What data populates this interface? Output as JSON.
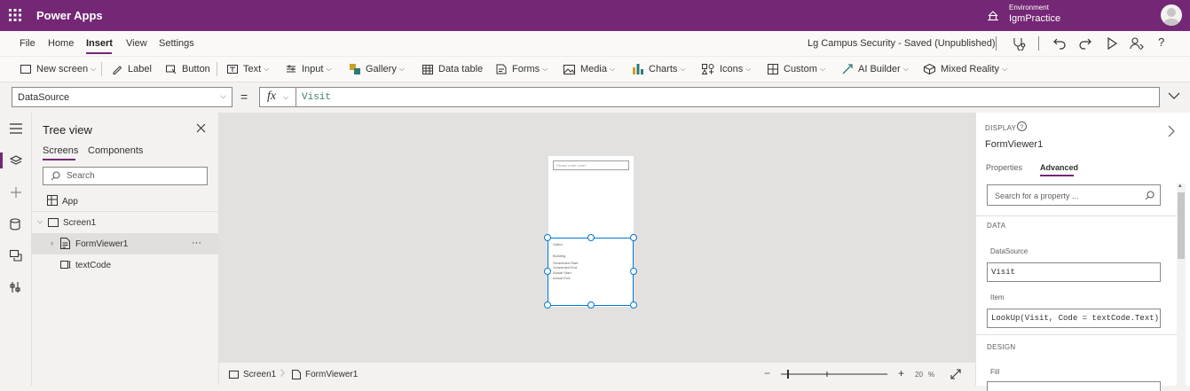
{
  "app": {
    "title": "Power Apps",
    "env_label": "Environment",
    "env_name": "IgmPractice"
  },
  "menu": {
    "items": [
      "File",
      "Home",
      "Insert",
      "View",
      "Settings"
    ],
    "active": "Insert",
    "status": "Lg Campus Security - Saved (Unpublished)"
  },
  "ribbon": {
    "new_screen": "New screen",
    "label": "Label",
    "button": "Button",
    "text": "Text",
    "input": "Input",
    "gallery": "Gallery",
    "data_table": "Data table",
    "forms": "Forms",
    "media": "Media",
    "charts": "Charts",
    "icons": "Icons",
    "custom": "Custom",
    "ai_builder": "AI Builder",
    "mixed_reality": "Mixed Reality"
  },
  "formula": {
    "property": "DataSource",
    "equals": "=",
    "fx": "fx",
    "value": "Visit"
  },
  "tree": {
    "title": "Tree view",
    "tabs": [
      "Screens",
      "Components"
    ],
    "search_placeholder": "Search",
    "app": "App",
    "screen": "Screen1",
    "form": "FormViewer1",
    "text_control": "textCode",
    "more": "···"
  },
  "canvas": {
    "input_placeholder": "Please enter code*",
    "form_fields": [
      "Visitor",
      "Building",
      "Scheduled Start",
      "Scheduled End",
      "Actual Start",
      "Actual End"
    ]
  },
  "statusbar": {
    "screen": "Screen1",
    "form": "FormViewer1",
    "zoom": "20",
    "zoom_unit": "%"
  },
  "props": {
    "display": "DISPLAY",
    "name": "FormViewer1",
    "tabs": [
      "Properties",
      "Advanced"
    ],
    "active_tab": "Advanced",
    "search_placeholder": "Search for a property ...",
    "data_head": "DATA",
    "datasource_label": "DataSource",
    "datasource_value": "Visit",
    "item_label": "Item",
    "item_value": "LookUp(Visit, Code = textCode.Text)",
    "design_head": "DESIGN",
    "fill_label": "Fill"
  },
  "colors": {
    "brand": "#742774",
    "selection": "#0078d4",
    "formula": "#3b7d6b"
  }
}
